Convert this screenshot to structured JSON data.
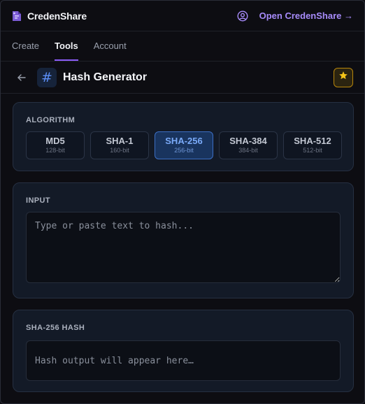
{
  "app": {
    "name": "CredenShare",
    "open_link": "Open CredenShare →"
  },
  "tabs": [
    {
      "label": "Create",
      "active": false
    },
    {
      "label": "Tools",
      "active": true
    },
    {
      "label": "Account",
      "active": false
    }
  ],
  "tool": {
    "title": "Hash Generator",
    "badge_glyph": "#",
    "favorite": true
  },
  "algorithm": {
    "label": "ALGORITHM",
    "selected": "SHA-256",
    "options": [
      {
        "name": "MD5",
        "bits": "128-bit"
      },
      {
        "name": "SHA-1",
        "bits": "160-bit"
      },
      {
        "name": "SHA-256",
        "bits": "256-bit"
      },
      {
        "name": "SHA-384",
        "bits": "384-bit"
      },
      {
        "name": "SHA-512",
        "bits": "512-bit"
      }
    ]
  },
  "input": {
    "label": "INPUT",
    "value": "",
    "placeholder": "Type or paste text to hash..."
  },
  "output": {
    "label": "SHA-256 HASH",
    "placeholder": "Hash output will appear here…"
  },
  "colors": {
    "accent": "#8b5cf6",
    "link": "#a78bfa",
    "selected_blue": "#7aaaf8",
    "star": "#f5c518"
  },
  "icons": {
    "brand": "credenshare-logo-icon",
    "user": "user-circle-icon",
    "back": "arrow-left-icon",
    "hash": "hash-icon",
    "favorite": "star-icon"
  }
}
